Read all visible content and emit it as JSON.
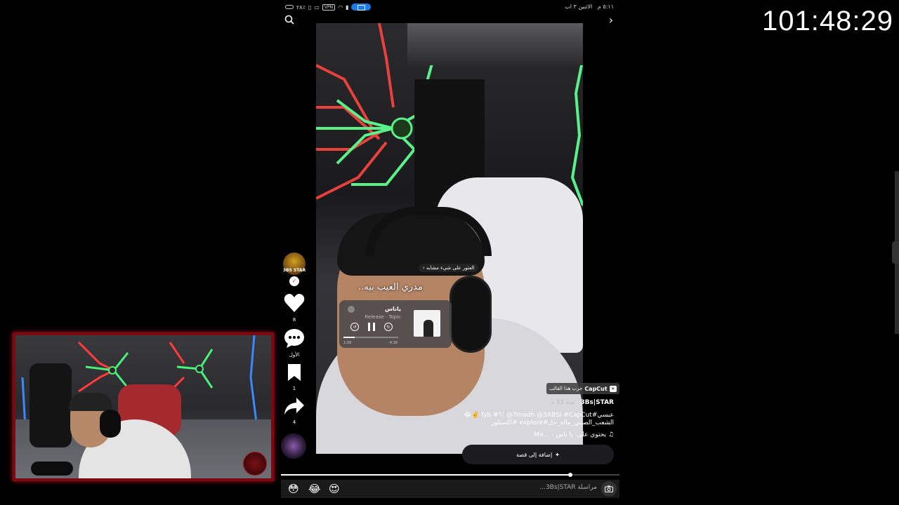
{
  "timer": "101:48:29",
  "status_bar": {
    "time": "٥:١١ م",
    "date": "الاثنين ٣ اب",
    "battery": "٢٨٪",
    "vpn": "VPN"
  },
  "overlay": {
    "find_similar": "العثور على شيء مشابه",
    "lyric": "مدري العيب بيه.."
  },
  "music_card": {
    "title": "ياناس",
    "subtitle": "Release · Topic",
    "time_current": "1:09",
    "time_total": "-4:16",
    "progress": 0.2
  },
  "sidebar": {
    "avatar_label": "3BS STAR",
    "likes": "8",
    "comments": "الأول",
    "saves": "1",
    "shares": "4"
  },
  "video_info": {
    "capcut_label": "CapCut",
    "capcut_action": "جرب هذا القالب",
    "author": "3Bs|STAR",
    "date": "منذ 33 د",
    "caption": "عبسي#fyb #🤍@7madh @3ABSI #CapCut ✌️😂الشعب_الصيني_ماله_حل#explore #اكسبلور",
    "sound": "يحتوي على: يا ناس - ...Ma",
    "add_story": "إضافة إلى قصة",
    "progress": 0.855
  },
  "bottom_bar": {
    "message_placeholder": "مراسلة 3Bs|STAR...",
    "emojis": [
      "😳",
      "😂",
      "😍"
    ]
  },
  "colors": {
    "accent_cast": "#1e7ae8",
    "webcam_border": "#7a0a10"
  }
}
